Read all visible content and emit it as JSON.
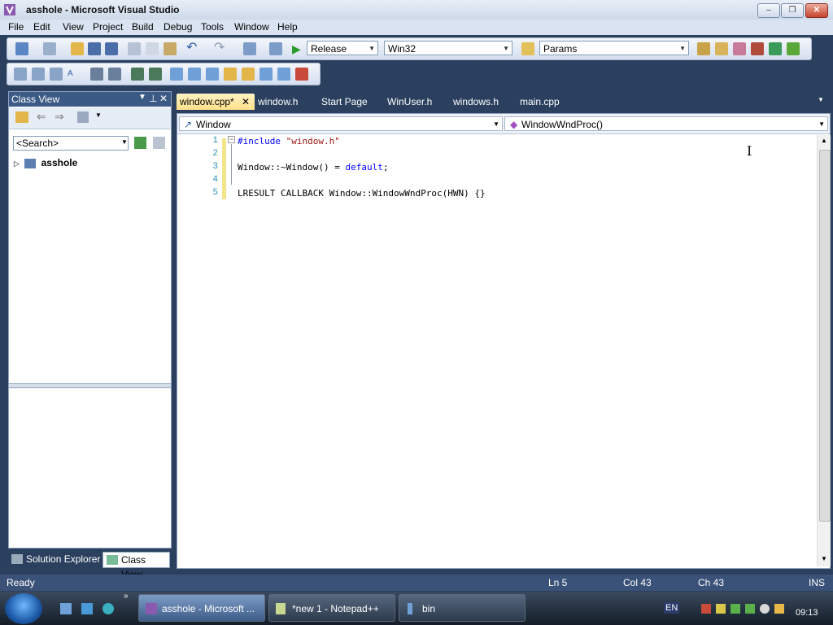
{
  "window": {
    "title": "asshole - Microsoft Visual Studio"
  },
  "menu": [
    "File",
    "Edit",
    "View",
    "Project",
    "Build",
    "Debug",
    "Tools",
    "Window",
    "Help"
  ],
  "toolbar": {
    "config": "Release",
    "platform": "Win32",
    "find": "Params"
  },
  "class_view": {
    "title": "Class View",
    "search_placeholder": "<Search>",
    "tree_root": "asshole"
  },
  "panel_tabs": [
    "Solution Explorer",
    "Class View"
  ],
  "doc_tabs": [
    "window.cpp*",
    "window.h",
    "Start Page",
    "WinUser.h",
    "windows.h",
    "main.cpp"
  ],
  "nav": {
    "type": "Window",
    "member": "WindowWndProc()"
  },
  "code_lines": [
    {
      "num": "1",
      "parts": [
        {
          "t": "#include ",
          "c": "kw"
        },
        {
          "t": "\"window.h\"",
          "c": "str"
        }
      ]
    },
    {
      "num": "2",
      "parts": []
    },
    {
      "num": "3",
      "parts": [
        {
          "t": "Window::~Window() = ",
          "c": ""
        },
        {
          "t": "default",
          "c": "kw"
        },
        {
          "t": ";",
          "c": ""
        }
      ]
    },
    {
      "num": "4",
      "parts": []
    },
    {
      "num": "5",
      "parts": [
        {
          "t": "LRESULT CALLBACK Window::WindowWndProc(HWN) {}",
          "c": ""
        }
      ]
    }
  ],
  "status": {
    "ready": "Ready",
    "ln": "Ln 5",
    "col": "Col 43",
    "ch": "Ch 43",
    "mode": "INS"
  },
  "taskbar": {
    "tasks": [
      "asshole - Microsoft ...",
      "*new  1 - Notepad++",
      "bin"
    ],
    "lang": "EN",
    "clock": "09:13"
  },
  "colors": {
    "accent": "#3b5a86",
    "active_tab": "#ffe08a",
    "keyword": "#0000ff",
    "string": "#a31515"
  }
}
